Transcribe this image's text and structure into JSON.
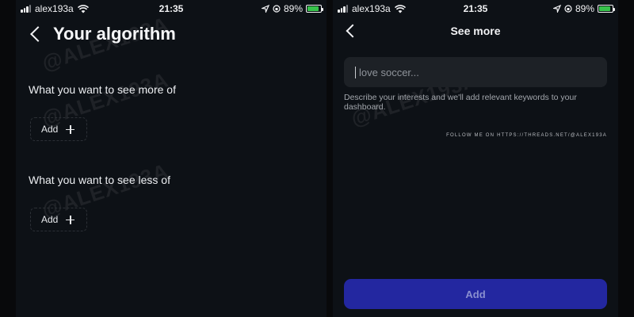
{
  "status_bar": {
    "carrier": "alex193a",
    "time": "21:35",
    "battery": "89%",
    "battery_level": 0.89
  },
  "left_screen": {
    "title": "Your algorithm",
    "sections": [
      {
        "heading": "What you want to see more of",
        "add_label": "Add"
      },
      {
        "heading": "What you want to see less of",
        "add_label": "Add"
      }
    ],
    "watermark": "@ALEX193A"
  },
  "right_screen": {
    "title": "See more",
    "input": {
      "placeholder": "love soccer..."
    },
    "helper_text": "Describe your interests and we'll add relevant keywords to your dashboard.",
    "credit": "FOLLOW ME ON HTTPS://THREADS.NET/@ALEX193A",
    "add_button_label": "Add",
    "watermark": "@ALEX193A"
  },
  "colors": {
    "background": "#0d1116",
    "input_background": "#1d2126",
    "add_button": "#2327a0",
    "battery_fill": "#37c24b"
  },
  "icons": [
    "back-chevron-icon",
    "plus-icon",
    "wifi-icon",
    "signal-icon",
    "location-icon",
    "orientation-lock-icon",
    "battery-icon"
  ]
}
